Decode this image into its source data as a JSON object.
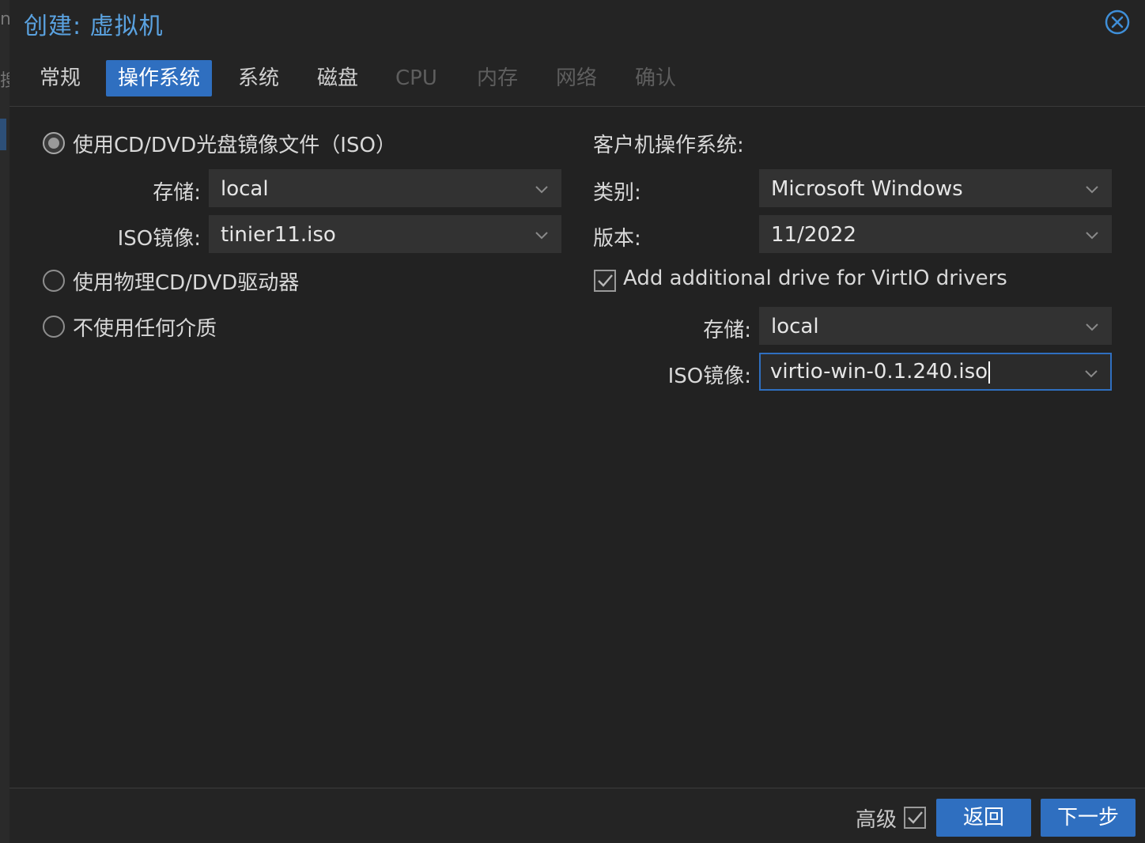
{
  "window": {
    "title": "创建: 虚拟机"
  },
  "tabs": [
    {
      "label": "常规",
      "state": "normal"
    },
    {
      "label": "操作系统",
      "state": "active"
    },
    {
      "label": "系统",
      "state": "normal"
    },
    {
      "label": "磁盘",
      "state": "normal"
    },
    {
      "label": "CPU",
      "state": "disabled"
    },
    {
      "label": "内存",
      "state": "disabled"
    },
    {
      "label": "网络",
      "state": "disabled"
    },
    {
      "label": "确认",
      "state": "disabled"
    }
  ],
  "media": {
    "options": [
      {
        "label": "使用CD/DVD光盘镜像文件（ISO）",
        "checked": true
      },
      {
        "label": "使用物理CD/DVD驱动器",
        "checked": false
      },
      {
        "label": "不使用任何介质",
        "checked": false
      }
    ],
    "storage_label": "存储:",
    "storage_value": "local",
    "iso_label": "ISO镜像:",
    "iso_value": "tinier11.iso"
  },
  "guest_os": {
    "heading": "客户机操作系统:",
    "type_label": "类别:",
    "type_value": "Microsoft Windows",
    "version_label": "版本:",
    "version_value": "11/2022",
    "virtio_checkbox_label": "Add additional drive for VirtIO drivers",
    "virtio_checked": true,
    "storage_label": "存储:",
    "storage_value": "local",
    "iso_label": "ISO镜像:",
    "iso_value": "virtio-win-0.1.240.iso"
  },
  "footer": {
    "advanced_label": "高级",
    "advanced_checked": true,
    "back_label": "返回",
    "next_label": "下一步"
  },
  "colors": {
    "accent": "#2f6fc0",
    "title": "#5aa2e0",
    "background": "#242424"
  }
}
